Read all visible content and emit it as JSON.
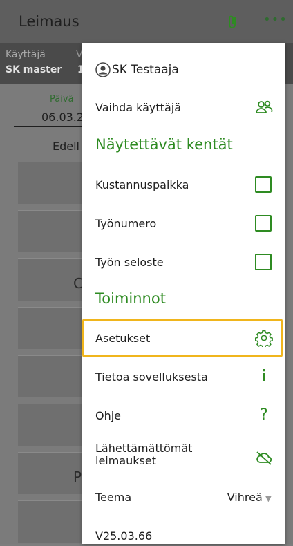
{
  "appbar": {
    "title": "Leimaus",
    "attach_icon": "paperclip-icon",
    "more_icon": "more-horizontal-icon"
  },
  "userbar": {
    "user_label": "Käyttäjä",
    "user_value": "SK master",
    "cut_label": "V",
    "cut_value": "1"
  },
  "background": {
    "date_label": "Päivä",
    "date_value": "06.03.2",
    "prev_label": "Edell",
    "letter_c": "C",
    "letter_p": "P"
  },
  "menu": {
    "user_name": "SK Testaaja",
    "switch_user": "Vaihda käyttäjä",
    "fields_heading": "Näytettävät kentät",
    "field_cost_center": "Kustannuspaikka",
    "field_job_number": "Työnumero",
    "field_job_description": "Työn seloste",
    "actions_heading": "Toiminnot",
    "settings": "Asetukset",
    "about": "Tietoa sovelluksesta",
    "help": "Ohje",
    "unsent_line1": "Lähettämättömät",
    "unsent_line2": "leimaukset",
    "theme_label": "Teema",
    "theme_value": "Vihreä",
    "version": "V25.03.66"
  },
  "colors": {
    "accent": "#2e8b22",
    "highlight": "#f0b51c"
  }
}
